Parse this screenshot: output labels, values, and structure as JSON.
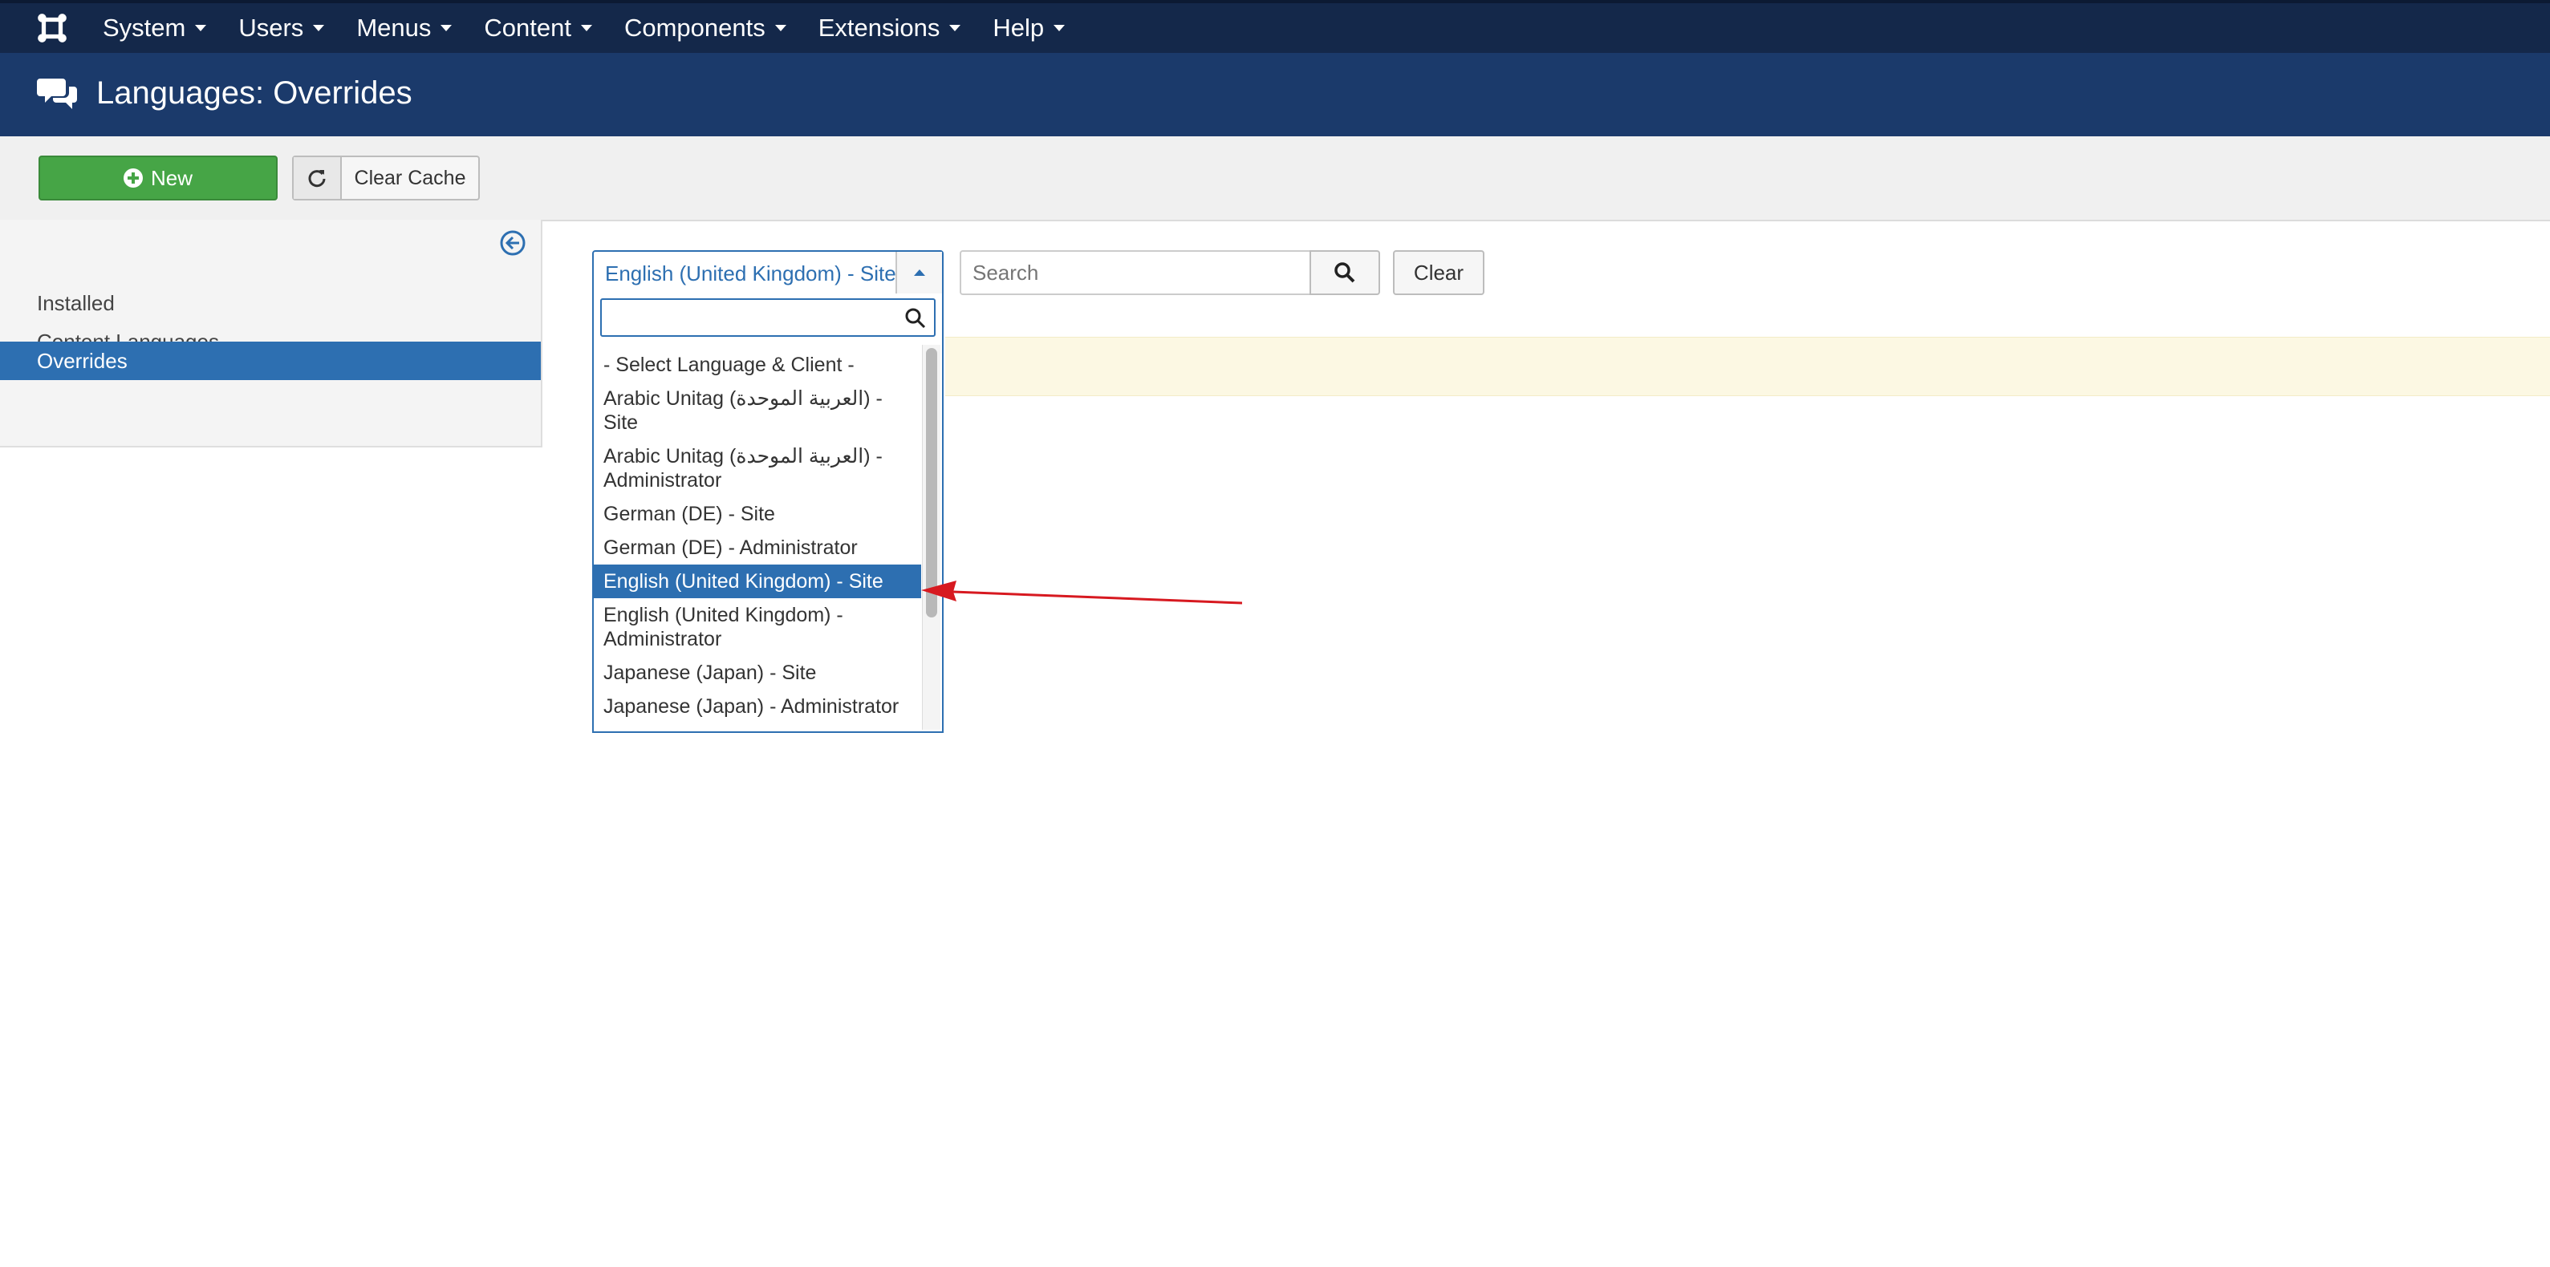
{
  "navbar": {
    "logo_icon": "joomla-logo-icon",
    "menu": [
      {
        "label": "System"
      },
      {
        "label": "Users"
      },
      {
        "label": "Menus"
      },
      {
        "label": "Content"
      },
      {
        "label": "Components"
      },
      {
        "label": "Extensions"
      },
      {
        "label": "Help"
      }
    ]
  },
  "header": {
    "icon": "comments-icon",
    "title": "Languages: Overrides"
  },
  "toolbar": {
    "new_label": "New",
    "clear_cache_label": "Clear Cache"
  },
  "sidebar": {
    "items": [
      {
        "label": "Installed",
        "active": false
      },
      {
        "label": "Content Languages",
        "active": false
      },
      {
        "label": "Overrides",
        "active": true
      }
    ]
  },
  "filter": {
    "language_selected": "English (United Kingdom) - Site",
    "dropdown_search_value": "",
    "options": [
      {
        "label": "- Select Language & Client -"
      },
      {
        "label": "Arabic Unitag (العربية الموحدة) - Site"
      },
      {
        "label": "Arabic Unitag (العربية الموحدة) - Administrator"
      },
      {
        "label": "German (DE) - Site"
      },
      {
        "label": "German (DE) - Administrator"
      },
      {
        "label": "English (United Kingdom) - Site",
        "selected": true
      },
      {
        "label": "English (United Kingdom) - Administrator"
      },
      {
        "label": "Japanese (Japan) - Site"
      },
      {
        "label": "Japanese (Japan) - Administrator"
      }
    ],
    "search_placeholder": "Search",
    "clear_label": "Clear"
  },
  "colors": {
    "navbar": "#14284a",
    "titlebar": "#1b3a6b",
    "accent": "#2d6fb1",
    "new_button": "#46a546",
    "notice": "#fcf8e3",
    "annotation_arrow": "#d71920"
  }
}
